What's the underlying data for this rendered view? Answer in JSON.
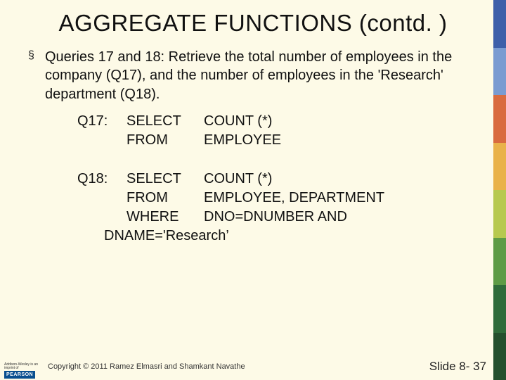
{
  "title": "AGGREGATE FUNCTIONS (contd. )",
  "bullet": {
    "marker": "§",
    "text": "Queries 17 and 18: Retrieve the total number of employees in the company (Q17), and the number of employees in the 'Research' department (Q18)."
  },
  "q17": {
    "label": "Q17:",
    "lines": [
      {
        "kw": "SELECT",
        "arg": "COUNT (*)"
      },
      {
        "kw": "FROM",
        "arg": "EMPLOYEE"
      }
    ]
  },
  "q18": {
    "label": "Q18:",
    "lines": [
      {
        "kw": "SELECT",
        "arg": "COUNT (*)"
      },
      {
        "kw": "FROM",
        "arg": "EMPLOYEE, DEPARTMENT"
      },
      {
        "kw": "WHERE",
        "arg": "DNO=DNUMBER AND"
      }
    ],
    "cont": "DNAME='Research’"
  },
  "footer": {
    "imprint": "Addison-Wesley is an imprint of",
    "brand": "PEARSON",
    "copyright": "Copyright © 2011 Ramez Elmasri and Shamkant Navathe",
    "slide": "Slide 8- 37"
  },
  "stripes": [
    "#3e5fa9",
    "#7a9bd1",
    "#d96b3f",
    "#e9b24a",
    "#b7c94f",
    "#5e9b46",
    "#2f6b3a",
    "#244f2d"
  ]
}
